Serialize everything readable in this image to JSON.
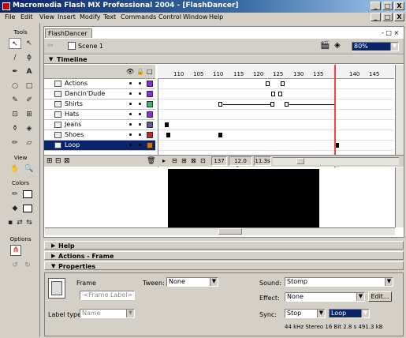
{
  "app": {
    "title": "Macromedia Flash MX Professional 2004 - [FlashDancer]",
    "window_buttons": [
      "_",
      "□",
      "X"
    ],
    "inner_buttons": [
      "_",
      "□",
      "X"
    ]
  },
  "menu": [
    "File",
    "Edit",
    "View",
    "Insert",
    "Modify",
    "Text",
    "Commands",
    "Control",
    "Window",
    "Help"
  ],
  "tools": {
    "header": "Tools",
    "view_label": "View",
    "colors_label": "Colors",
    "options_label": "Options",
    "icons": [
      "arrow-icon",
      "subselect-icon",
      "line-icon",
      "lasso-icon",
      "pen-icon",
      "text-icon",
      "oval-icon",
      "rectangle-icon",
      "pencil-icon",
      "brush-icon",
      "free-transform-icon",
      "fill-transform-icon",
      "ink-bottle-icon",
      "paint-bucket-icon",
      "eyedropper-icon",
      "eraser-icon"
    ],
    "icon_glyphs": [
      "↖",
      "↖",
      "/",
      "ϕ",
      "✒",
      "A",
      "○",
      "□",
      "✎",
      "✐",
      "⊡",
      "⊞",
      "⚱",
      "◈",
      "✏",
      "▱"
    ],
    "view_glyphs": [
      "✋",
      "🔍"
    ],
    "stroke_glyph": "✏",
    "fill_glyph": "◆",
    "small_glyphs": [
      "▪",
      "⇄",
      "⇆"
    ],
    "option_glyphs": [
      "⋔",
      "↺",
      "↻"
    ]
  },
  "document": {
    "tab": "FlashDancer",
    "scene": "Scene 1",
    "zoom": "80%",
    "tab_controls": "- □ ×"
  },
  "timeline": {
    "label": "Timeline",
    "header_icons": [
      "👁",
      "🔒",
      "□"
    ],
    "ruler_ticks": [
      "110",
      "105",
      "110",
      "115",
      "120",
      "125",
      "130",
      "135",
      "140",
      "145"
    ],
    "layers": [
      {
        "name": "Actions",
        "color": "#8a2be2"
      },
      {
        "name": "Dancin'Dude",
        "color": "#8a2be2"
      },
      {
        "name": "Shirts",
        "color": "#3cb371"
      },
      {
        "name": "Hats",
        "color": "#8a2be2"
      },
      {
        "name": "Jeans",
        "color": "#5a5aa0"
      },
      {
        "name": "Shoes",
        "color": "#d02020"
      },
      {
        "name": "Loop",
        "color": "#e07000"
      }
    ],
    "current_frame": "137",
    "fps": "12.0 fps",
    "time": "11.3s",
    "footer_icons": [
      "⊞",
      "⊟",
      "⊠"
    ]
  },
  "panels": {
    "help": "Help",
    "actions": "Actions - Frame",
    "properties": "Properties"
  },
  "properties": {
    "frame_label": "Frame",
    "frame_placeholder": "<Frame Label>",
    "tween_label": "Tween:",
    "tween_value": "None",
    "sound_label": "Sound:",
    "sound_value": "Stomp",
    "effect_label": "Effect:",
    "effect_value": "None",
    "edit_button": "Edit...",
    "label_type_label": "Label type:",
    "label_type_value": "Name",
    "sync_label": "Sync:",
    "sync_value": "Stop",
    "loop_value": "Loop",
    "sound_info": "44 kHz Stereo 16 Bit 2.8 s 491.3 kB"
  },
  "colors": {
    "stroke": "#000000",
    "fill": "#000000",
    "accent": "#0a246a"
  }
}
